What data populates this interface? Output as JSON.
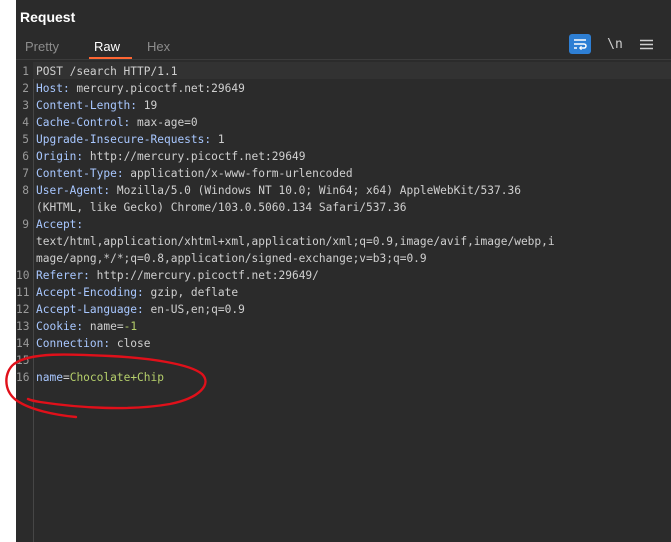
{
  "panel": {
    "title": "Request"
  },
  "tabs": [
    {
      "label": "Pretty",
      "active": false
    },
    {
      "label": "Raw",
      "active": true
    },
    {
      "label": "Hex",
      "active": false
    }
  ],
  "toolbar": {
    "wrap_icon": "word-wrap-icon",
    "newline_label": "\\n",
    "menu_icon": "hamburger-menu-icon"
  },
  "lines": [
    {
      "n": "1",
      "parts": [
        {
          "t": "POST /search HTTP/1.1",
          "c": "hv"
        }
      ]
    },
    {
      "n": "2",
      "parts": [
        {
          "t": "Host:",
          "c": "hk"
        },
        {
          "t": " mercury.picoctf.net:29649",
          "c": "hv"
        }
      ]
    },
    {
      "n": "3",
      "parts": [
        {
          "t": "Content-Length:",
          "c": "hk"
        },
        {
          "t": " 19",
          "c": "hv"
        }
      ]
    },
    {
      "n": "4",
      "parts": [
        {
          "t": "Cache-Control:",
          "c": "hk"
        },
        {
          "t": " max-age=0",
          "c": "hv"
        }
      ]
    },
    {
      "n": "5",
      "parts": [
        {
          "t": "Upgrade-Insecure-Requests:",
          "c": "hk"
        },
        {
          "t": " 1",
          "c": "hv"
        }
      ]
    },
    {
      "n": "6",
      "parts": [
        {
          "t": "Origin:",
          "c": "hk"
        },
        {
          "t": " http://mercury.picoctf.net:29649",
          "c": "hv"
        }
      ]
    },
    {
      "n": "7",
      "parts": [
        {
          "t": "Content-Type:",
          "c": "hk"
        },
        {
          "t": " application/x-www-form-urlencoded",
          "c": "hv"
        }
      ]
    },
    {
      "n": "8",
      "parts": [
        {
          "t": "User-Agent:",
          "c": "hk"
        },
        {
          "t": " Mozilla/5.0 (Windows NT 10.0; Win64; x64) AppleWebKit/537.36",
          "c": "hv"
        }
      ]
    },
    {
      "n": "",
      "parts": [
        {
          "t": "(KHTML, like Gecko) Chrome/103.0.5060.134 Safari/537.36",
          "c": "hv"
        }
      ]
    },
    {
      "n": "9",
      "parts": [
        {
          "t": "Accept:",
          "c": "hk"
        }
      ]
    },
    {
      "n": "",
      "parts": [
        {
          "t": "text/html,application/xhtml+xml,application/xml;q=0.9,image/avif,image/webp,i",
          "c": "hv"
        }
      ]
    },
    {
      "n": "",
      "parts": [
        {
          "t": "mage/apng,*/*;q=0.8,application/signed-exchange;v=b3;q=0.9",
          "c": "hv"
        }
      ]
    },
    {
      "n": "10",
      "parts": [
        {
          "t": "Referer:",
          "c": "hk"
        },
        {
          "t": " http://mercury.picoctf.net:29649/",
          "c": "hv"
        }
      ]
    },
    {
      "n": "11",
      "parts": [
        {
          "t": "Accept-Encoding:",
          "c": "hk"
        },
        {
          "t": " gzip, deflate",
          "c": "hv"
        }
      ]
    },
    {
      "n": "12",
      "parts": [
        {
          "t": "Accept-Language:",
          "c": "hk"
        },
        {
          "t": " en-US,en;q=0.9",
          "c": "hv"
        }
      ]
    },
    {
      "n": "13",
      "parts": [
        {
          "t": "Cookie:",
          "c": "hk"
        },
        {
          "t": " name=",
          "c": "hv"
        },
        {
          "t": "-1",
          "c": "pv"
        }
      ]
    },
    {
      "n": "14",
      "parts": [
        {
          "t": "Connection:",
          "c": "hk"
        },
        {
          "t": " close",
          "c": "hv"
        }
      ]
    },
    {
      "n": "15",
      "parts": [
        {
          "t": "",
          "c": "hv"
        }
      ]
    },
    {
      "n": "16",
      "parts": [
        {
          "t": "name",
          "c": "pk"
        },
        {
          "t": "=",
          "c": "hv"
        },
        {
          "t": "Chocolate+Chip",
          "c": "pv"
        }
      ]
    }
  ],
  "colors": {
    "accent": "#ff6633",
    "annotation": "#e0101a",
    "wrap_button": "#2e7fd4"
  }
}
